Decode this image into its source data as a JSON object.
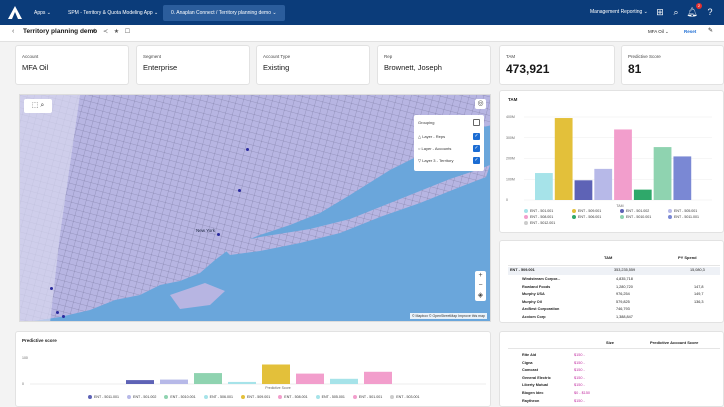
{
  "nav": {
    "apps_label": "Apps",
    "tab1_label": "SPM - Territory & Quota Modeling App",
    "tab2_label": "0. Anaplan Connect / Territory planning demo",
    "management_label": "Management Reporting",
    "notification_count": "2",
    "help_label": "?"
  },
  "subheader": {
    "title": "Territory planning demo",
    "filter_label": "MFA Oil",
    "reset_label": "Reset"
  },
  "cards": {
    "account": {
      "label": "Account",
      "value": "MFA Oil"
    },
    "segment": {
      "label": "Segment",
      "value": "Enterprise"
    },
    "account_type": {
      "label": "Account Type",
      "value": "Existing"
    },
    "rep": {
      "label": "Rep",
      "value": "Brownett, Joseph"
    },
    "tam": {
      "label": "TAM",
      "value": "473,921"
    },
    "predictive_score": {
      "label": "Predictive Score",
      "value": "81"
    }
  },
  "map": {
    "city_label": "New York",
    "layers_title": "Grouping",
    "layers": [
      "Layer - Reps",
      "Layer - Accounts",
      "Layer 3 - Territory"
    ],
    "attribution": "© Mapbox © OpenStreetMap  Improve this map"
  },
  "tam_chart": {
    "title": "TAM",
    "xlabel": "TAM",
    "legend": [
      "ENT - 501.001",
      "ENT - 509.001",
      "ENT - 501.002",
      "ENT - 505.001",
      "ENT - 508.001",
      "ENT - 506.001",
      "ENT - 5010.001",
      "ENT - 5011.001",
      "ENT - 5012.001"
    ],
    "y_ticks": [
      "400M",
      "300M",
      "200M",
      "100M",
      "0"
    ]
  },
  "chart_data": [
    {
      "type": "bar",
      "title": "TAM",
      "xlabel": "TAM",
      "ylim": [
        0,
        400
      ],
      "y_ticks": [
        "0",
        "100M",
        "200M",
        "300M",
        "400M"
      ],
      "categories": [
        "ENT - 501.001",
        "ENT - 509.001",
        "ENT - 501.002",
        "ENT - 505.001",
        "ENT - 508.001",
        "ENT - 506.001",
        "ENT - 5010.001",
        "ENT - 5011.001",
        "ENT - 5012.001"
      ],
      "values": [
        130,
        395,
        95,
        150,
        340,
        50,
        255,
        210,
        0
      ],
      "colors": [
        "#a6e3e9",
        "#e3c03a",
        "#5e63b6",
        "#b7b9e8",
        "#f29ecc",
        "#2fa86a",
        "#8fd3b0",
        "#7a88d4",
        "#cccccc"
      ]
    },
    {
      "type": "bar",
      "title": "Predictive score",
      "xlabel": "Predictive Score",
      "ylim": [
        0,
        100
      ],
      "y_ticks": [
        "0",
        "100"
      ],
      "categories": [
        "ENT - 5011.001",
        "ENT - 501.002",
        "ENT - 5010.001",
        "ENT - 506.001",
        "ENT - 509.001",
        "ENT - 508.001",
        "ENT - 505.001",
        "ENT - 501.001",
        "ENT - 503.001"
      ],
      "values": [
        15,
        17,
        42,
        8,
        75,
        40,
        20,
        47,
        0
      ],
      "colors": [
        "#5e63b6",
        "#b7b9e8",
        "#8fd3b0",
        "#a6e3e9",
        "#e3c03a",
        "#f29ecc",
        "#a6e3e9",
        "#f29ecc",
        "#cccccc"
      ]
    }
  ],
  "pred_chart": {
    "title": "Predictive score",
    "xlabel": "Predictive Score",
    "y_top": "100",
    "y_bottom": "0",
    "legend": [
      "ENT - 5011.001",
      "ENT - 501.002",
      "ENT - 5010.001",
      "ENT - 506.001",
      "ENT - 509.001",
      "ENT - 508.001",
      "ENT - 505.001",
      "ENT - 501.001",
      "ENT - 503.001"
    ]
  },
  "tam_table": {
    "headers": [
      "TAM",
      "PY Spend"
    ],
    "group_row": {
      "name": "ENT - 509.001",
      "tam": "353,235,559",
      "spend": "15,080,3"
    },
    "rows": [
      {
        "name": "Windstream Corpor...",
        "tam": "4,835,718",
        "spend": ""
      },
      {
        "name": "Rowland Foods",
        "tam": "1,280,720",
        "spend": "147,8"
      },
      {
        "name": "Murphy USA",
        "tam": "976,254",
        "spend": "149,7"
      },
      {
        "name": "Murphy Oil",
        "tam": "579,825",
        "spend": "136,3"
      },
      {
        "name": "ArcBest Corporation",
        "tam": "746,793",
        "spend": ""
      },
      {
        "name": "Acxiom Corp",
        "tam": "1,388,847",
        "spend": ""
      }
    ]
  },
  "score_table": {
    "headers": [
      "Size",
      "Predictive Account Score"
    ],
    "rows": [
      {
        "name": "Rite Aid",
        "size": "$150 -"
      },
      {
        "name": "Cigna",
        "size": "$150 -"
      },
      {
        "name": "Comcast",
        "size": "$150 -"
      },
      {
        "name": "General Electric",
        "size": "$150 -"
      },
      {
        "name": "Liberty Mutual",
        "size": "$150 -"
      },
      {
        "name": "Biogen Idec",
        "size": "$0 - $150"
      },
      {
        "name": "Raytheon",
        "size": "$150 -"
      }
    ]
  },
  "colors": {
    "nav_bg": "#0b3c7a",
    "map_water": "#6aa6db",
    "map_land": "#b7b5e2",
    "accent": "#1b6cd3"
  }
}
